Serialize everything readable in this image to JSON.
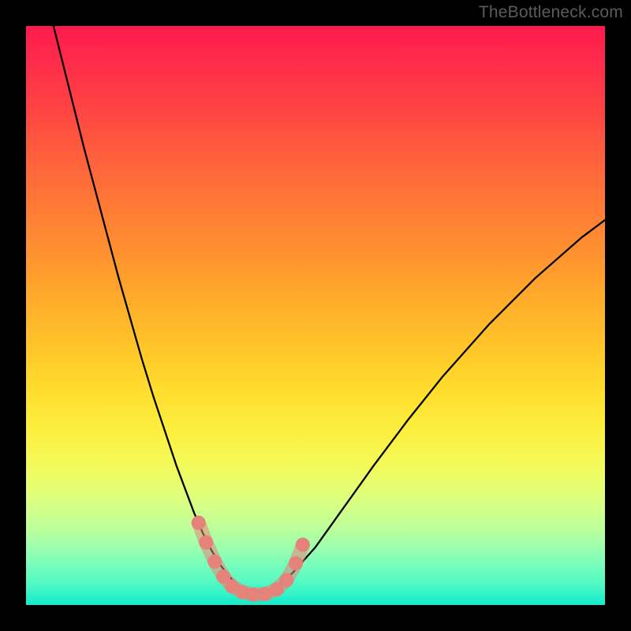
{
  "watermark": "TheBottleneck.com",
  "colors": {
    "frame": "#000000",
    "curve": "#000000",
    "markers_fill": "#e5837b",
    "markers_stroke": "#d16b63"
  },
  "chart_data": {
    "type": "line",
    "title": "",
    "xlabel": "",
    "ylabel": "",
    "xlim": [
      0,
      100
    ],
    "ylim": [
      0,
      100
    ],
    "grid": false,
    "legend": false,
    "series": [
      {
        "name": "curve",
        "x": [
          4,
          6,
          8,
          10,
          12,
          14,
          16,
          18,
          20,
          22,
          24,
          26,
          27.5,
          29,
          30.5,
          32,
          33.5,
          35,
          37,
          39,
          41,
          43,
          46,
          50,
          55,
          60,
          66,
          72,
          80,
          88,
          96,
          100
        ],
        "y": [
          103,
          95,
          87,
          79,
          71.5,
          64,
          56.5,
          49.5,
          42.5,
          36,
          30,
          24,
          20,
          16,
          12.5,
          9.5,
          7,
          5,
          3,
          2,
          2,
          3,
          5.5,
          10,
          17,
          24,
          32,
          39.5,
          48.5,
          56.5,
          63.5,
          66.5
        ]
      }
    ],
    "markers": [
      {
        "x": 29.8,
        "y": 14.2
      },
      {
        "x": 31.1,
        "y": 10.8
      },
      {
        "x": 32.6,
        "y": 7.5
      },
      {
        "x": 34.1,
        "y": 4.9
      },
      {
        "x": 35.6,
        "y": 3.2
      },
      {
        "x": 37.4,
        "y": 2.2
      },
      {
        "x": 39.3,
        "y": 1.8
      },
      {
        "x": 41.3,
        "y": 1.9
      },
      {
        "x": 43.3,
        "y": 2.7
      },
      {
        "x": 45.0,
        "y": 4.3
      },
      {
        "x": 46.6,
        "y": 7.2
      },
      {
        "x": 47.8,
        "y": 10.4
      }
    ]
  }
}
